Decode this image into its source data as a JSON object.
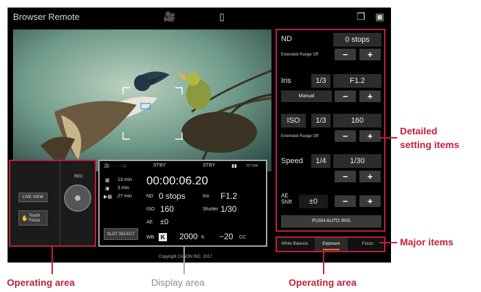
{
  "header": {
    "title": "Browser Remote"
  },
  "panel": {
    "nd": {
      "label": "ND",
      "value": "0 stops",
      "extended": "Extended Range Off"
    },
    "iris": {
      "label": "Iris",
      "step": "1/3",
      "value": "F1.2",
      "mode": "Manual"
    },
    "iso": {
      "label": "ISO",
      "step": "1/3",
      "value": "160",
      "extended": "Extended Range Off"
    },
    "speed": {
      "label": "Speed",
      "step": "1/4",
      "value": "1/30"
    },
    "ae_shift": {
      "label": "AE\nShift",
      "value": "±0"
    },
    "minus": "−",
    "plus": "+",
    "push_auto_iris": "PUSH AUTO IRIS"
  },
  "tabs": [
    "White Balance",
    "Exposure",
    "Focus"
  ],
  "operating": {
    "rec_label": "REC",
    "live_view": "LIVE VIEW",
    "touch_focus": "Touch\nFocus"
  },
  "display": {
    "top_left": "STBY",
    "top_right": "STBY",
    "battery": "117 min",
    "media1": "13 min",
    "media2": "3 min",
    "media3": "27 min",
    "timecode": "00:00:06.20",
    "nd_label": "ND",
    "nd_value": "0 stops",
    "iris_label": "Iris",
    "iris_value": "F1.2",
    "iso_label": "ISO",
    "iso_value": "160",
    "shutter_label": "Shutter",
    "shutter_value": "1/30",
    "ae_label": "AE",
    "ae_value": "±0",
    "wb_label": "WB",
    "wb_value": "2000",
    "wb_unit": "K",
    "wb_cc": "−20",
    "wb_cc_unit": "CC",
    "slot_select": "SLOT SELECT"
  },
  "copyright": "Copyright CANON INC. 2017",
  "annotations": {
    "detailed": "Detailed\nsetting items",
    "major": "Major items",
    "op_left": "Operating area",
    "display": "Display area",
    "op_right": "Operating area"
  },
  "colors": {
    "annotation": "#c21f3a",
    "accent": "#e8741c"
  }
}
